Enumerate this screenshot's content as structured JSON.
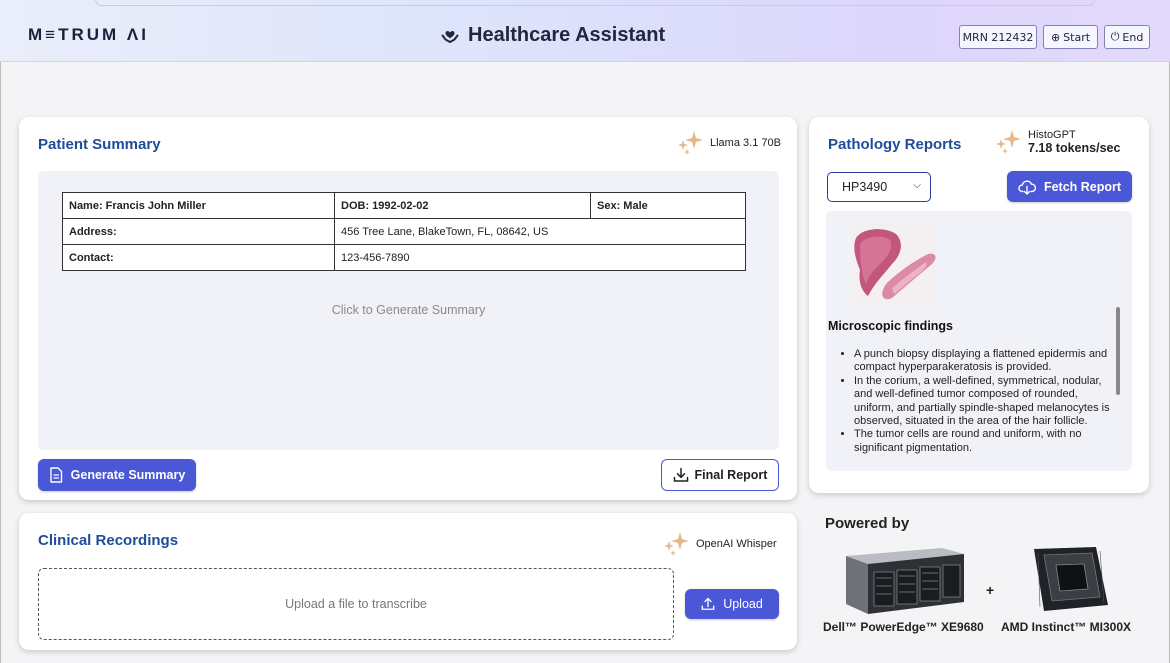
{
  "header": {
    "logo": "M≡TRUM ΛI",
    "title": "Healthcare Assistant",
    "mrn": "MRN 212432",
    "start_label": "Start",
    "end_label": "End"
  },
  "patient_summary": {
    "title": "Patient Summary",
    "model": "Llama 3.1 70B",
    "table": {
      "name": "Name: Francis John Miller",
      "dob": "DOB: 1992-02-02",
      "sex": "Sex: Male",
      "address_label": "Address:",
      "address_value": "456 Tree Lane, BlakeTown, FL, 08642, US",
      "contact_label": "Contact:",
      "contact_value": "123-456-7890"
    },
    "hint": "Click to Generate Summary",
    "generate_label": "Generate Summary",
    "final_report_label": "Final Report"
  },
  "pathology": {
    "title": "Pathology Reports",
    "model": "HistoGPT",
    "speed": "7.18 tokens/sec",
    "selected_report": "HP3490",
    "fetch_label": "Fetch Report",
    "findings_title": "Microscopic findings",
    "findings": [
      "A punch biopsy displaying a flattened epidermis and compact hyperparakeratosis is provided.",
      "In the corium, a well-defined, symmetrical, nodular, and well-defined tumor composed of rounded, uniform, and partially spindle-shaped melanocytes is observed, situated in the area of the hair follicle.",
      "The tumor cells are round and uniform, with no significant pigmentation."
    ]
  },
  "clinical_recordings": {
    "title": "Clinical Recordings",
    "model": "OpenAI Whisper",
    "dropzone": "Upload a file to transcribe",
    "upload_label": "Upload"
  },
  "powered_by": {
    "title": "Powered by",
    "plus": "+",
    "server": "Dell™ PowerEdge™ XE9680",
    "gpu": "AMD Instinct™ MI300X"
  },
  "colors": {
    "accent": "#4a57d7",
    "title_blue": "#1f4c9a",
    "sparkle": "#e8b88a"
  }
}
